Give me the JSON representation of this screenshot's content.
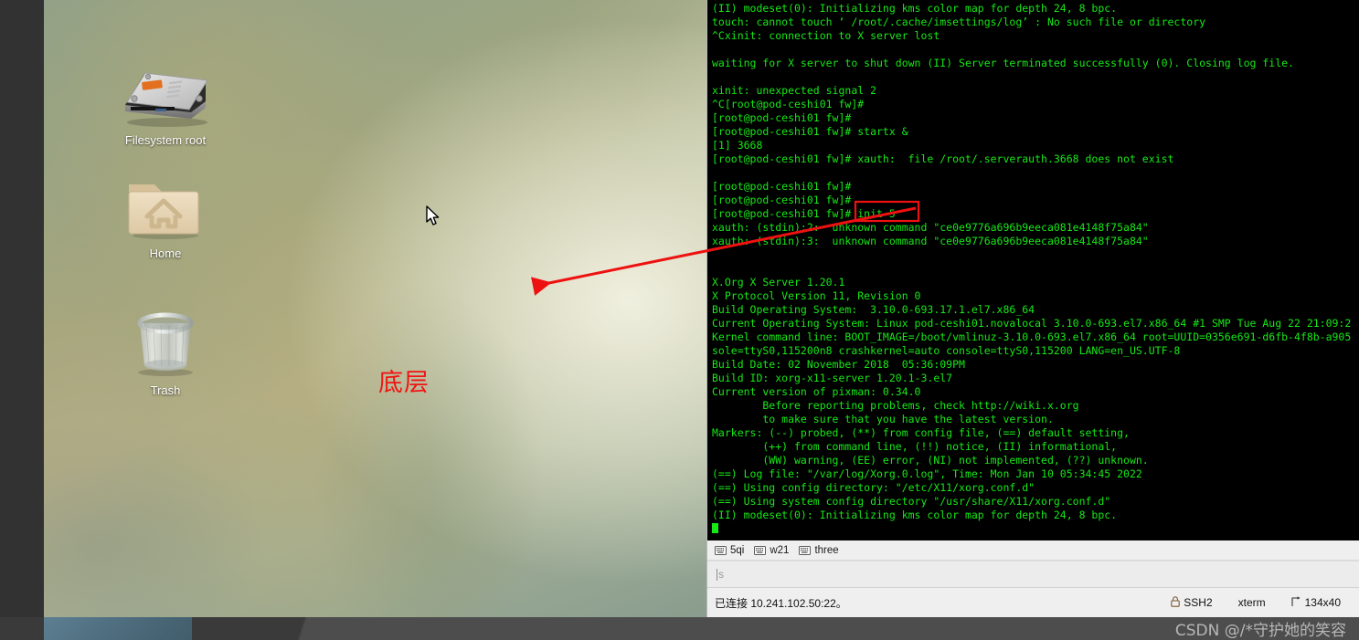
{
  "desktop": {
    "icons": [
      {
        "id": "filesystem-root",
        "label": "Filesystem root",
        "icon": "hard-drive-icon"
      },
      {
        "id": "home",
        "label": "Home",
        "icon": "home-folder-icon"
      },
      {
        "id": "trash",
        "label": "Trash",
        "icon": "trash-bin-icon"
      }
    ]
  },
  "annotation": {
    "text": "底层",
    "text_color": "#f01414",
    "arrow_color": "#ee1111",
    "highlight_box_target": "init 5"
  },
  "watermark": {
    "text": "CSDN @/*守护她的笑容"
  },
  "terminal": {
    "lines": [
      "(II) modeset(0): Initializing kms color map for depth 24, 8 bpc.",
      "touch: cannot touch ‘ /root/.cache/imsettings/log’ : No such file or directory",
      "^Cxinit: connection to X server lost",
      "",
      "waiting for X server to shut down (II) Server terminated successfully (0). Closing log file.",
      "",
      "xinit: unexpected signal 2",
      "^C[root@pod-ceshi01 fw]#",
      "[root@pod-ceshi01 fw]#",
      "[root@pod-ceshi01 fw]# startx &",
      "[1] 3668",
      "[root@pod-ceshi01 fw]# xauth:  file /root/.serverauth.3668 does not exist",
      "",
      "[root@pod-ceshi01 fw]#",
      "[root@pod-ceshi01 fw]#",
      "[root@pod-ceshi01 fw]# init 5",
      "xauth: (stdin):2:  unknown command \"ce0e9776a696b9eeca081e4148f75a84\"",
      "xauth: (stdin):3:  unknown command \"ce0e9776a696b9eeca081e4148f75a84\"",
      "",
      "",
      "X.Org X Server 1.20.1",
      "X Protocol Version 11, Revision 0",
      "Build Operating System:  3.10.0-693.17.1.el7.x86_64",
      "Current Operating System: Linux pod-ceshi01.novalocal 3.10.0-693.el7.x86_64 #1 SMP Tue Aug 22 21:09:2",
      "Kernel command line: BOOT_IMAGE=/boot/vmlinuz-3.10.0-693.el7.x86_64 root=UUID=0356e691-d6fb-4f8b-a905",
      "sole=ttyS0,115200n8 crashkernel=auto console=ttyS0,115200 LANG=en_US.UTF-8",
      "Build Date: 02 November 2018  05:36:09PM",
      "Build ID: xorg-x11-server 1.20.1-3.el7",
      "Current version of pixman: 0.34.0",
      "        Before reporting problems, check http://wiki.x.org",
      "        to make sure that you have the latest version.",
      "Markers: (--) probed, (**) from config file, (==) default setting,",
      "        (++) from command line, (!!) notice, (II) informational,",
      "        (WW) warning, (EE) error, (NI) not implemented, (??) unknown.",
      "(==) Log file: \"/var/log/Xorg.0.log\", Time: Mon Jan 10 05:34:45 2022",
      "(==) Using config directory: \"/etc/X11/xorg.conf.d\"",
      "(==) Using system config directory \"/usr/share/X11/xorg.conf.d\"",
      "(II) modeset(0): Initializing kms color map for depth 24, 8 bpc."
    ],
    "text_color": "#17e817",
    "background": "#000000",
    "tabs": [
      {
        "label": "5qi",
        "icon": "terminal-tab-icon"
      },
      {
        "label": "w21",
        "icon": "terminal-tab-icon"
      },
      {
        "label": "three",
        "icon": "terminal-tab-icon"
      }
    ],
    "command_input": {
      "value": "s",
      "placeholder": ""
    },
    "status": {
      "connection": "已连接 10.241.102.50:22。",
      "protocol": "SSH2",
      "protocol_icon": "lock-icon",
      "emulation": "xterm",
      "size": "134x40",
      "size_icon": "resize-icon"
    }
  }
}
